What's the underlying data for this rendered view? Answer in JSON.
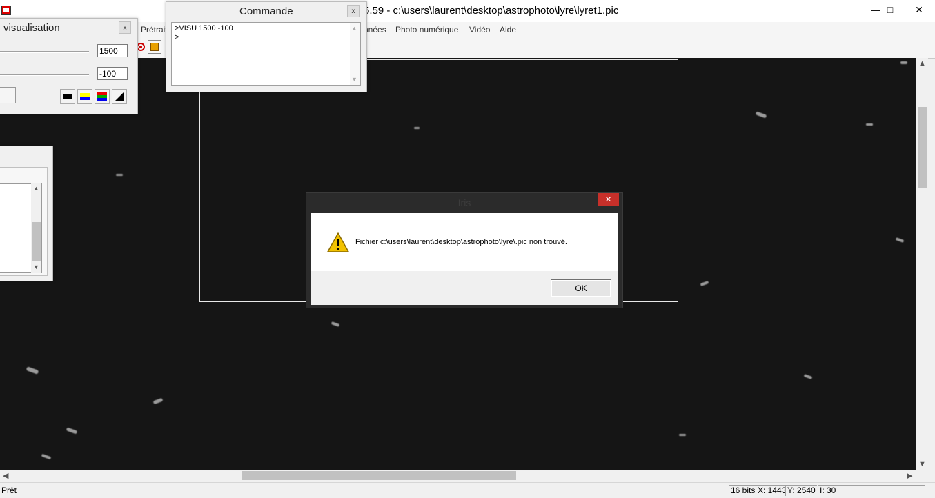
{
  "window": {
    "title": "5.59 - c:\\users\\laurent\\desktop\\astrophoto\\lyre\\lyret1.pic",
    "minimize_glyph": "—",
    "maximize_glyph": "□",
    "close_glyph": "✕"
  },
  "menu": {
    "items": [
      "Prétrait",
      "nnées",
      "Photo numérique",
      "Vidéo",
      "Aide"
    ]
  },
  "visualisation_panel": {
    "title": "visualisation",
    "close_glyph": "x",
    "high_threshold": "1500",
    "low_threshold": "-100",
    "palette_buttons": [
      "bw-palette-icon",
      "blue-yellow-palette-icon",
      "rainbow-palette-icon",
      "gradient-palette-icon"
    ]
  },
  "command_window": {
    "title": "Commande",
    "close_glyph": "x",
    "text": ">VISU 1500 -100\n>"
  },
  "dialog": {
    "title": "Iris",
    "close_glyph": "✕",
    "icon": "warning-icon",
    "message": "Fichier c:\\users\\laurent\\desktop\\astrophoto\\lyre\\.pic non trouvé.",
    "ok_label": "OK"
  },
  "statusbar": {
    "status": "Prêt",
    "bits": "16 bits",
    "x": "X: 1443",
    "y": "Y: 2540",
    "intensity": "I: 30"
  },
  "colors": {
    "image_background": "#151515",
    "dialog_close": "#c7302a"
  }
}
